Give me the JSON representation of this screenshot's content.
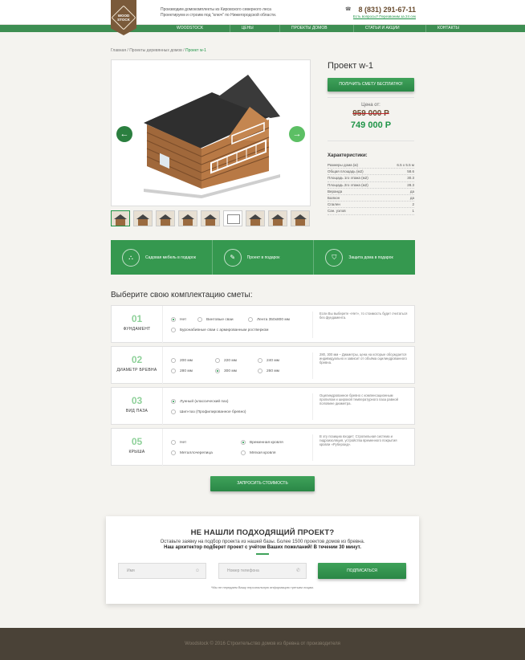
{
  "header": {
    "logo_text": "WOOD STOCK",
    "tagline_1": "Производим домокомплекты из Кировского северного леса",
    "tagline_2": "Проектируем и строим под \"ключ\" по Нижегородской области.",
    "phone": "8 (831) 291-67-11",
    "callback": "Есть вопросы? Перезвоним за 24 сек"
  },
  "nav": [
    "WOODSTOCK",
    "ЦЕНЫ",
    "ПРОЕКТЫ ДОМОВ",
    "СТАТЬИ И АКЦИИ",
    "КОНТАКТЫ"
  ],
  "breadcrumb": {
    "home": "Главная",
    "sep1": " / ",
    "section": "Проекты деревянных домов",
    "sep2": " / ",
    "current": "Проект w-1"
  },
  "project": {
    "title": "Проект w-1",
    "quote_button": "ПОЛУЧИТЬ СМЕТУ БЕСПЛАТНО!",
    "price_label": "Цена от:",
    "price_old": "959 000  Р",
    "price_new": "749 000  Р",
    "chars_title": "Характеристики:",
    "chars": [
      {
        "k": "Размеры дома (м)",
        "v": "6.5 х 5.5 м"
      },
      {
        "k": "Общая площадь (м2)",
        "v": "58.6"
      },
      {
        "k": "Площадь 1го этажа (м2)",
        "v": "30.3"
      },
      {
        "k": "Площадь 2го этажа (м2)",
        "v": "28.3"
      },
      {
        "k": "Веранда",
        "v": "да"
      },
      {
        "k": "Балкон",
        "v": "да"
      },
      {
        "k": "Спален",
        "v": "2"
      },
      {
        "k": "Сан. узлов",
        "v": "1"
      }
    ]
  },
  "gallery": {
    "prev_icon": "←",
    "next_icon": "→"
  },
  "promos": [
    {
      "label": "Садовая мебель в подарок",
      "icon": "⛬"
    },
    {
      "label": "Проект в подарок",
      "icon": "✎"
    },
    {
      "label": "Защита дома в подарок",
      "icon": "⛉"
    }
  ],
  "choose_title": "Выберите свою комплектацию сметы:",
  "options": [
    {
      "num": "01",
      "name": "ФУНДАМЕНТ",
      "radios": [
        "Нет",
        "Винтовые сваи",
        "Лента 350х800 мм",
        "Буронабивные сваи с армированным ростверком"
      ],
      "note": "Если Вы выберете «Нет», то стоимость будет считаться без фундамента."
    },
    {
      "num": "02",
      "name": "ДИАМЕТР БРЕВНА",
      "radios": [
        "200 мм",
        "220 мм",
        "240 мм",
        "280 мм",
        "300 мм",
        "260 мм"
      ],
      "note": "280, 300 мм – Диаметры, цена на которые обсуждается индивидуально и зависит от объёма оцилиндрованного бревна."
    },
    {
      "num": "03",
      "name": "ВИД ПАЗА",
      "radios": [
        "Лунный (классический паз)",
        "Шип-паз (Профилированное бревно)"
      ],
      "note": "Оцилиндрованное бревно с компенсационным пропилом и широкой температурного паза равной половине диаметра."
    },
    {
      "num": "05",
      "name": "КРЫША",
      "radios": [
        "Нет",
        "Временная кровля",
        "Металлочерепица",
        "Мягкая кровля"
      ],
      "note": "В эту позицию входит: Стропильная система и гидроизоляция, устройства временного покрытия кровли «Рубероид»."
    }
  ],
  "request_button": "ЗАПРОСИТЬ СТОИМОСТЬ",
  "lead": {
    "title": "НЕ НАШЛИ ПОДХОДЯЩИЙ ПРОЕКТ?",
    "line1": "Оставьте заявку на подбор проекта из нашей базы. Более 1500 проектов домов из бревна.",
    "line2": "Наш архитектор подберет проект с учётом Ваших пожеланий! В течении 30 минут.",
    "name_placeholder": "Имя",
    "phone_placeholder": "Номер телефона",
    "submit": "ПОДПИСАТЬСЯ",
    "note": "*Мы не передаем Вашу персональную информацию третьим лицам."
  },
  "footer": "Woodstock © 2016 Строительство домов из бревна от производителя"
}
